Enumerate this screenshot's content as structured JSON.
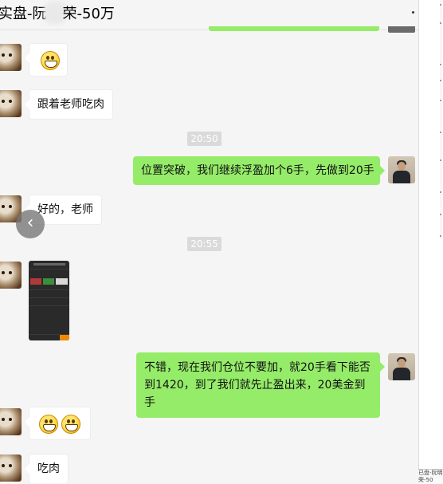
{
  "header": {
    "title_prefix": "实盘-阮",
    "title_suffix": "荣-50万",
    "more_icon": "more-icon"
  },
  "messages": [
    {
      "side": "left",
      "type": "emoji",
      "emoji": "grin-emoji"
    },
    {
      "side": "left",
      "type": "text",
      "text": "跟着老师吃肉"
    },
    {
      "type": "time",
      "text": "20:50"
    },
    {
      "side": "right",
      "type": "text",
      "text": "位置突破，我们继续浮盈加个6手，先做到20手"
    },
    {
      "side": "left",
      "type": "text",
      "text": "好的，老师"
    },
    {
      "type": "time",
      "text": "20:55"
    },
    {
      "side": "left",
      "type": "image",
      "description": "trading-app-screenshot"
    },
    {
      "side": "right",
      "type": "text",
      "text": "不错，现在我们仓位不要加，就20手看下能否到1420，到了我们就先止盈出来，20美金到手"
    },
    {
      "side": "left",
      "type": "emoji",
      "emoji": "grin-emoji",
      "count": 2
    },
    {
      "side": "left",
      "type": "text",
      "text": "吃肉"
    }
  ],
  "footer": {
    "text": "已盘-阮明荣-50"
  },
  "colors": {
    "sent_bubble": "#95ec69",
    "received_bubble": "#ffffff",
    "background": "#f5f5f5"
  }
}
